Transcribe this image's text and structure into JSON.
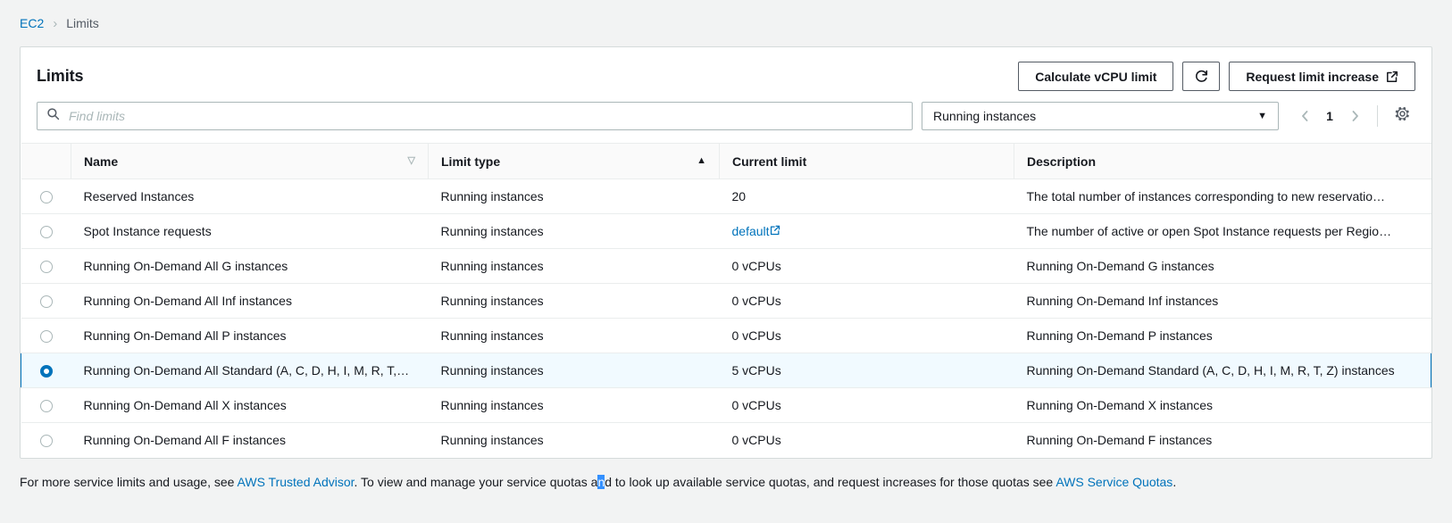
{
  "breadcrumb": {
    "root": "EC2",
    "separator": "›",
    "current": "Limits"
  },
  "header": {
    "title": "Limits",
    "calculate_button": "Calculate vCPU limit",
    "refresh_icon": "refresh-icon",
    "request_button": "Request limit increase",
    "external_icon": "external-link-icon"
  },
  "filters": {
    "search_placeholder": "Find limits",
    "search_value": "",
    "search_icon": "search-icon",
    "limit_type_selected": "Running instances",
    "caret_icon": "chevron-down-icon",
    "page_number": "1",
    "prev_icon": "chevron-left-icon",
    "next_icon": "chevron-right-icon",
    "settings_icon": "gear-icon"
  },
  "table": {
    "columns": [
      {
        "label": "Name",
        "sort": "none"
      },
      {
        "label": "Limit type",
        "sort": "asc"
      },
      {
        "label": "Current limit",
        "sort": "none"
      },
      {
        "label": "Description",
        "sort": "none"
      }
    ],
    "rows": [
      {
        "selected": false,
        "name": "Reserved Instances",
        "limit_type": "Running instances",
        "current_limit": "20",
        "limit_is_link": false,
        "description": "The total number of instances corresponding to new reservatio…"
      },
      {
        "selected": false,
        "name": "Spot Instance requests",
        "limit_type": "Running instances",
        "current_limit": "default",
        "limit_is_link": true,
        "description": "The number of active or open Spot Instance requests per Regio…"
      },
      {
        "selected": false,
        "name": "Running On-Demand All G instances",
        "limit_type": "Running instances",
        "current_limit": "0 vCPUs",
        "limit_is_link": false,
        "description": "Running On-Demand G instances"
      },
      {
        "selected": false,
        "name": "Running On-Demand All Inf instances",
        "limit_type": "Running instances",
        "current_limit": "0 vCPUs",
        "limit_is_link": false,
        "description": "Running On-Demand Inf instances"
      },
      {
        "selected": false,
        "name": "Running On-Demand All P instances",
        "limit_type": "Running instances",
        "current_limit": "0 vCPUs",
        "limit_is_link": false,
        "description": "Running On-Demand P instances"
      },
      {
        "selected": true,
        "name": "Running On-Demand All Standard (A, C, D, H, I, M, R, T,…",
        "limit_type": "Running instances",
        "current_limit": "5 vCPUs",
        "limit_is_link": false,
        "description": "Running On-Demand Standard (A, C, D, H, I, M, R, T, Z) instances"
      },
      {
        "selected": false,
        "name": "Running On-Demand All X instances",
        "limit_type": "Running instances",
        "current_limit": "0 vCPUs",
        "limit_is_link": false,
        "description": "Running On-Demand X instances"
      },
      {
        "selected": false,
        "name": "Running On-Demand All F instances",
        "limit_type": "Running instances",
        "current_limit": "0 vCPUs",
        "limit_is_link": false,
        "description": "Running On-Demand F instances"
      }
    ]
  },
  "footer": {
    "text_1": "For more service limits and usage, see ",
    "link_1": "AWS Trusted Advisor",
    "text_2": ". To view and manage your service quotas a",
    "selected_char": "n",
    "text_3": "d to look up available service quotas, and request increases for those quotas see ",
    "link_2": "AWS Service Quotas",
    "text_4": "."
  },
  "colors": {
    "link": "#0073bb",
    "selected_row_bg": "#f1faff",
    "selected_row_border": "#0073bb",
    "page_bg": "#f2f3f3",
    "selection_highlight": "#3390ff"
  }
}
